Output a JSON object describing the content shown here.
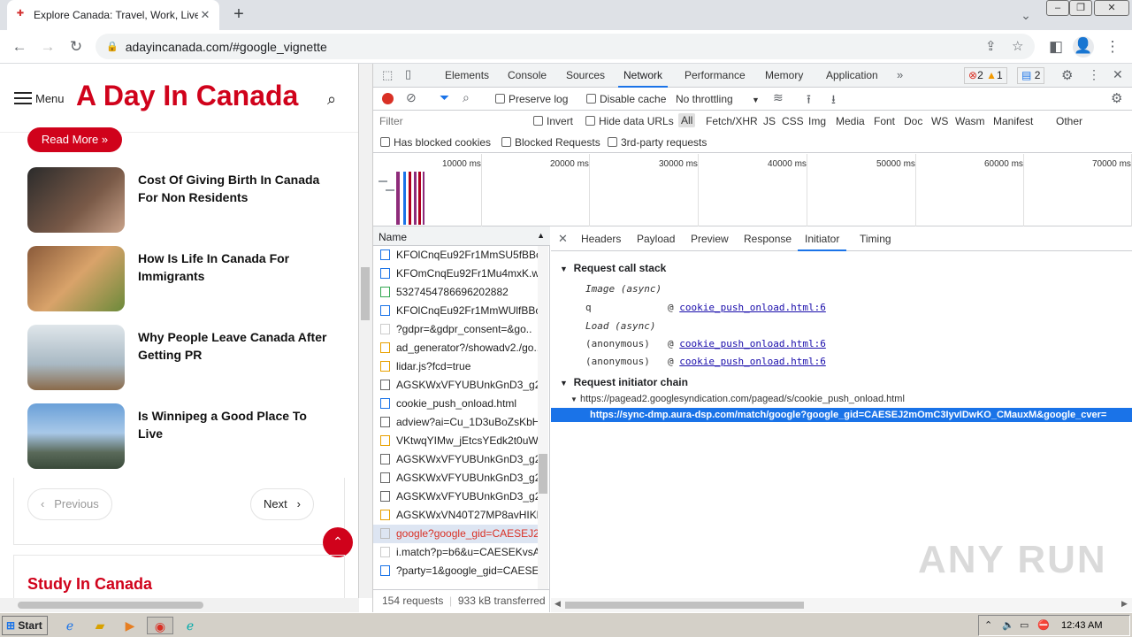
{
  "browser": {
    "tab_title": "Explore Canada: Travel, Work, Live,",
    "url": "adayincanada.com/#google_vignette"
  },
  "site": {
    "menu_label": "Menu",
    "logo": "A Day In Canada",
    "read_more": "Read More »",
    "posts": [
      {
        "title": "Cost Of Giving Birth In Canada For Non Residents"
      },
      {
        "title": "How Is Life In Canada For Immigrants"
      },
      {
        "title": "Why People Leave Canada After Getting PR"
      },
      {
        "title": "Is Winnipeg a Good Place To Live"
      }
    ],
    "prev": "Previous",
    "next": "Next",
    "study_title": "Study In Canada"
  },
  "devtools": {
    "tabs": [
      "Elements",
      "Console",
      "Sources",
      "Network",
      "Performance",
      "Memory",
      "Application"
    ],
    "errors": "2",
    "warnings": "1",
    "messages": "2",
    "toolbar": {
      "preserve_log": "Preserve log",
      "disable_cache": "Disable cache",
      "throttling": "No throttling"
    },
    "filter": {
      "placeholder": "Filter",
      "invert": "Invert",
      "hide_data": "Hide data URLs",
      "types": [
        "All",
        "Fetch/XHR",
        "JS",
        "CSS",
        "Img",
        "Media",
        "Font",
        "Doc",
        "WS",
        "Wasm",
        "Manifest",
        "Other"
      ],
      "blocked_cookies": "Has blocked cookies",
      "blocked_requests": "Blocked Requests",
      "third_party": "3rd-party requests"
    },
    "timeline_ticks": [
      "10000 ms",
      "20000 ms",
      "30000 ms",
      "40000 ms",
      "50000 ms",
      "60000 ms",
      "70000 ms"
    ],
    "name_header": "Name",
    "requests": [
      "KFOlCnqEu92Fr1MmSU5fBBc..",
      "KFOmCnqEu92Fr1Mu4mxK.w..",
      "5327454786696202882",
      "KFOlCnqEu92Fr1MmWUlfBBc..",
      "?gdpr=&gdpr_consent=&go..",
      "ad_generator?/showadv2./go..",
      "lidar.js?fcd=true",
      "AGSKWxVFYUBUnkGnD3_g2..",
      "cookie_push_onload.html",
      "adview?ai=Cu_1D3uBoZsKbH..",
      "VKtwqYIMw_jEtcsYEdk2t0uWx..",
      "AGSKWxVFYUBUnkGnD3_g2..",
      "AGSKWxVFYUBUnkGnD3_g2..",
      "AGSKWxVFYUBUnkGnD3_g2..",
      "AGSKWxVN40T27MP8avHIKk..",
      "google?google_gid=CAESEJ2..",
      "i.match?p=b6&u=CAESEKvsA..",
      "?party=1&google_gid=CAESE.."
    ],
    "selected_request_index": 15,
    "status": {
      "requests": "154 requests",
      "transferred": "933 kB transferred"
    },
    "detail_tabs": [
      "Headers",
      "Payload",
      "Preview",
      "Response",
      "Initiator",
      "Timing"
    ],
    "call_stack": {
      "title": "Request call stack",
      "rows": [
        {
          "fn": "Image (async)",
          "src": ""
        },
        {
          "fn": "q",
          "src": "cookie_push_onload.html:6"
        },
        {
          "fn": "Load (async)",
          "src": ""
        },
        {
          "fn": "(anonymous)",
          "src": "cookie_push_onload.html:6"
        },
        {
          "fn": "(anonymous)",
          "src": "cookie_push_onload.html:6"
        }
      ]
    },
    "initiator_chain": {
      "title": "Request initiator chain",
      "parent": "https://pagead2.googlesyndication.com/pagead/s/cookie_push_onload.html",
      "child": "https://sync-dmp.aura-dsp.com/match/google?google_gid=CAESEJ2mOmC3IyvIDwKO_CMauxM&google_cver="
    }
  },
  "taskbar": {
    "start": "Start",
    "clock": "12:43 AM"
  },
  "watermark": "ANY RUN"
}
